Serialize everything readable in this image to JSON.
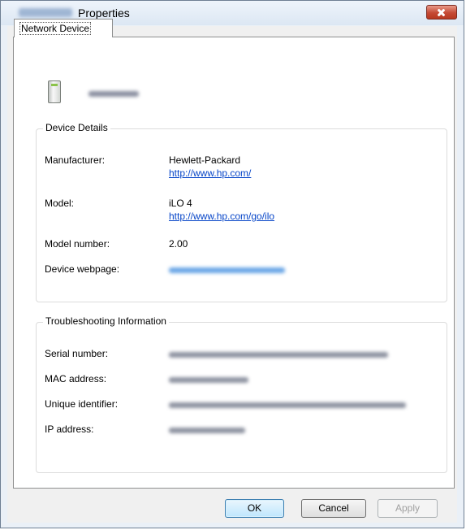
{
  "window": {
    "title": "Properties"
  },
  "tabs": [
    {
      "label": "Network Device"
    }
  ],
  "device_details": {
    "legend": "Device Details",
    "manufacturer_label": "Manufacturer:",
    "manufacturer_value": "Hewlett-Packard",
    "manufacturer_link": "http://www.hp.com/",
    "model_label": "Model:",
    "model_value": "iLO 4",
    "model_link": "http://www.hp.com/go/ilo",
    "model_number_label": "Model number:",
    "model_number_value": "2.00",
    "webpage_label": "Device webpage:"
  },
  "troubleshooting": {
    "legend": "Troubleshooting Information",
    "serial_label": "Serial number:",
    "mac_label": "MAC address:",
    "uid_label": "Unique identifier:",
    "ip_label": "IP address:"
  },
  "buttons": {
    "ok": "OK",
    "cancel": "Cancel",
    "apply": "Apply"
  },
  "icons": {
    "close": "close-icon",
    "device": "network-device-icon"
  },
  "colors": {
    "link": "#0645c8",
    "close_button": "#c54a35"
  }
}
